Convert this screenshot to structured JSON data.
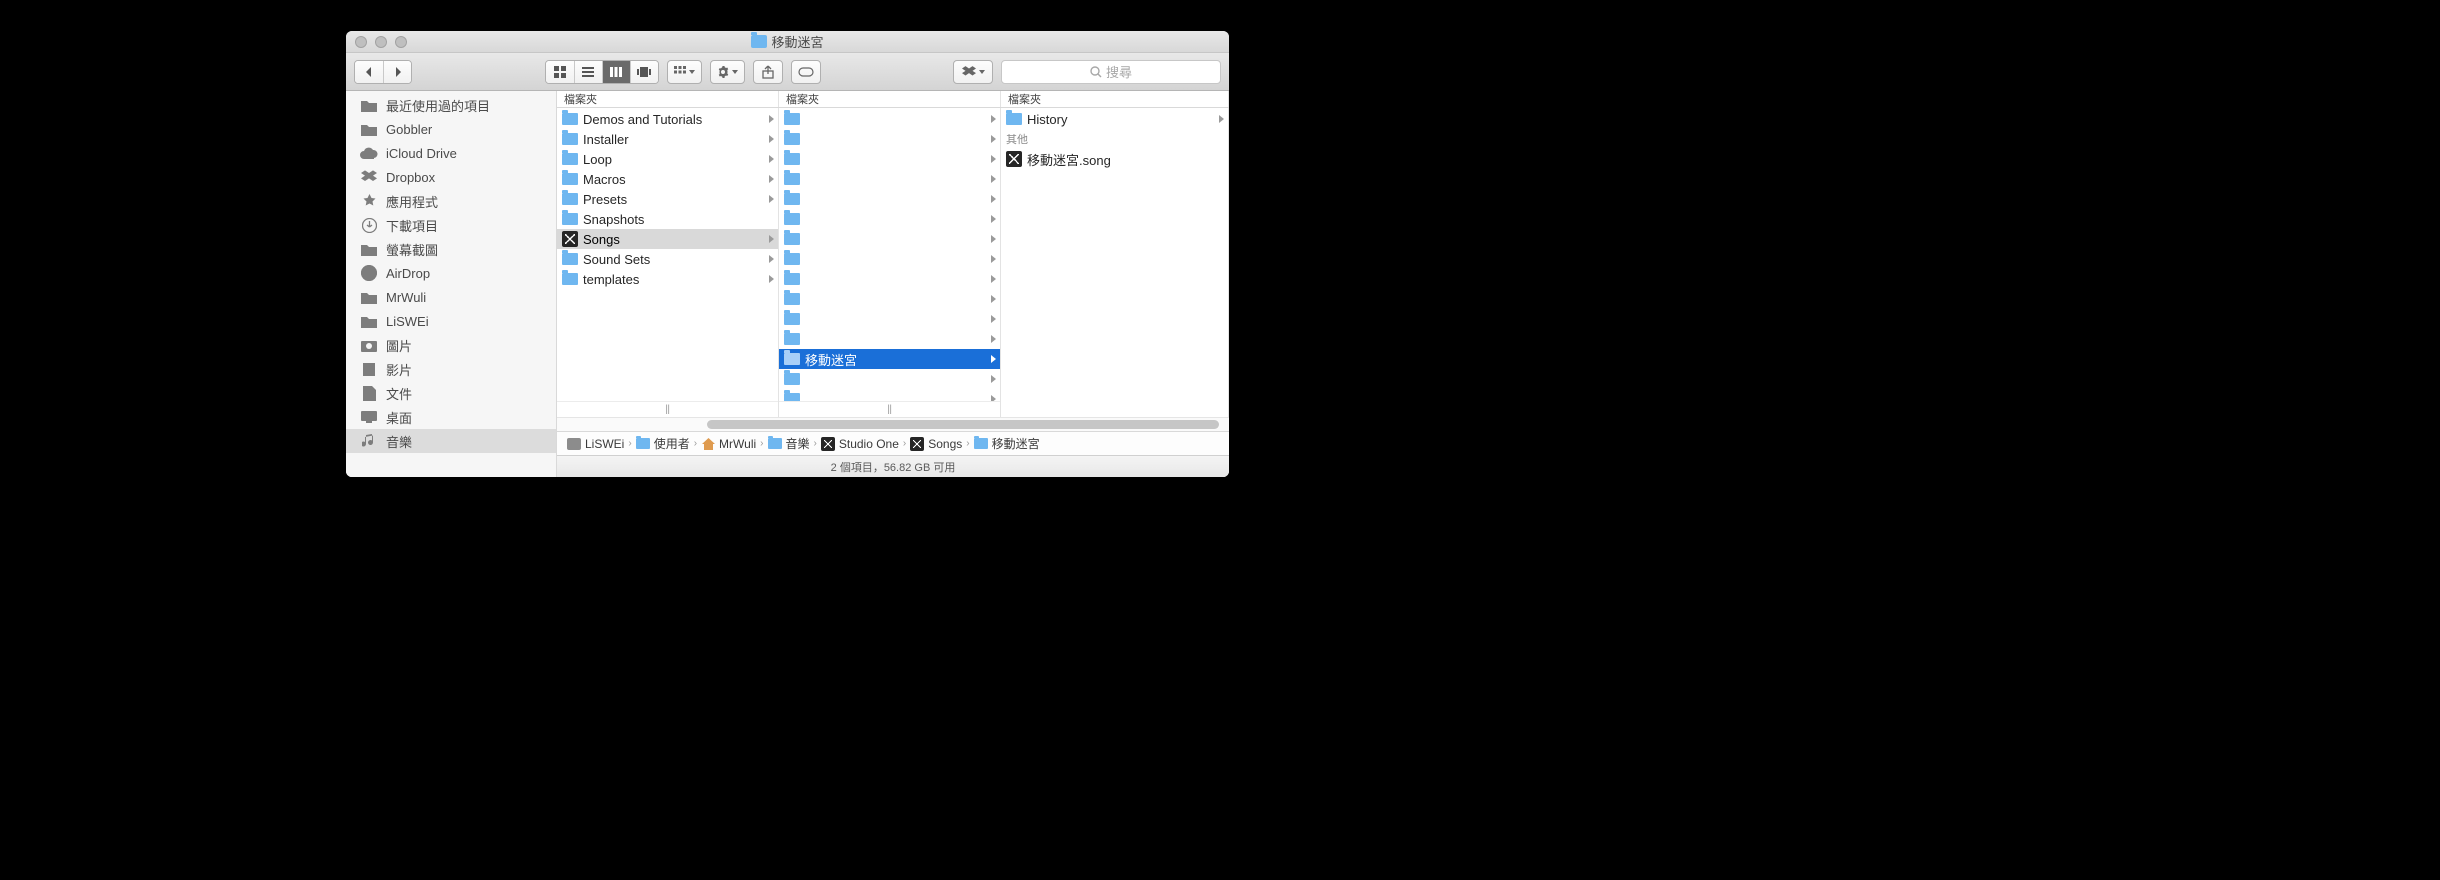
{
  "window": {
    "title": "移動迷宮"
  },
  "toolbar": {
    "search_placeholder": "搜尋"
  },
  "sidebar": {
    "items": [
      {
        "label": "最近使用過的項目",
        "icon": "folder"
      },
      {
        "label": "Gobbler",
        "icon": "folder"
      },
      {
        "label": "iCloud Drive",
        "icon": "cloud"
      },
      {
        "label": "Dropbox",
        "icon": "dropbox"
      },
      {
        "label": "應用程式",
        "icon": "apps"
      },
      {
        "label": "下載項目",
        "icon": "downloads"
      },
      {
        "label": "螢幕截圖",
        "icon": "folder"
      },
      {
        "label": "AirDrop",
        "icon": "airdrop"
      },
      {
        "label": "MrWuli",
        "icon": "folder"
      },
      {
        "label": "LiSWEi",
        "icon": "folder"
      },
      {
        "label": "圖片",
        "icon": "pictures"
      },
      {
        "label": "影片",
        "icon": "movies"
      },
      {
        "label": "文件",
        "icon": "documents"
      },
      {
        "label": "桌面",
        "icon": "desktop"
      },
      {
        "label": "音樂",
        "icon": "music",
        "selected": true
      }
    ]
  },
  "columns": {
    "header": "檔案夾",
    "col1": [
      {
        "label": "Demos and Tutorials",
        "folder": true,
        "chev": true
      },
      {
        "label": "Installer",
        "folder": true,
        "chev": true
      },
      {
        "label": "Loop",
        "folder": true,
        "chev": true
      },
      {
        "label": "Macros",
        "folder": true,
        "chev": true
      },
      {
        "label": "Presets",
        "folder": true,
        "chev": true
      },
      {
        "label": "Snapshots",
        "folder": true,
        "chev": false
      },
      {
        "label": "Songs",
        "folder": false,
        "app": true,
        "chev": true,
        "selbg": true
      },
      {
        "label": "Sound Sets",
        "folder": true,
        "chev": true
      },
      {
        "label": "templates",
        "folder": true,
        "chev": true
      }
    ],
    "col2_blank_above": 12,
    "col2_selected": {
      "label": "移動迷宮"
    },
    "col2_blank_below": 2,
    "col3": {
      "history": "History",
      "section": "其他",
      "file": "移動迷宮.song"
    }
  },
  "pathbar": [
    {
      "label": "LiSWEi",
      "icon": "disk"
    },
    {
      "label": "使用者",
      "icon": "folder"
    },
    {
      "label": "MrWuli",
      "icon": "home"
    },
    {
      "label": "音樂",
      "icon": "folder"
    },
    {
      "label": "Studio One",
      "icon": "so"
    },
    {
      "label": "Songs",
      "icon": "so"
    },
    {
      "label": "移動迷宮",
      "icon": "folder"
    }
  ],
  "status": "2 個項目，56.82 GB 可用"
}
